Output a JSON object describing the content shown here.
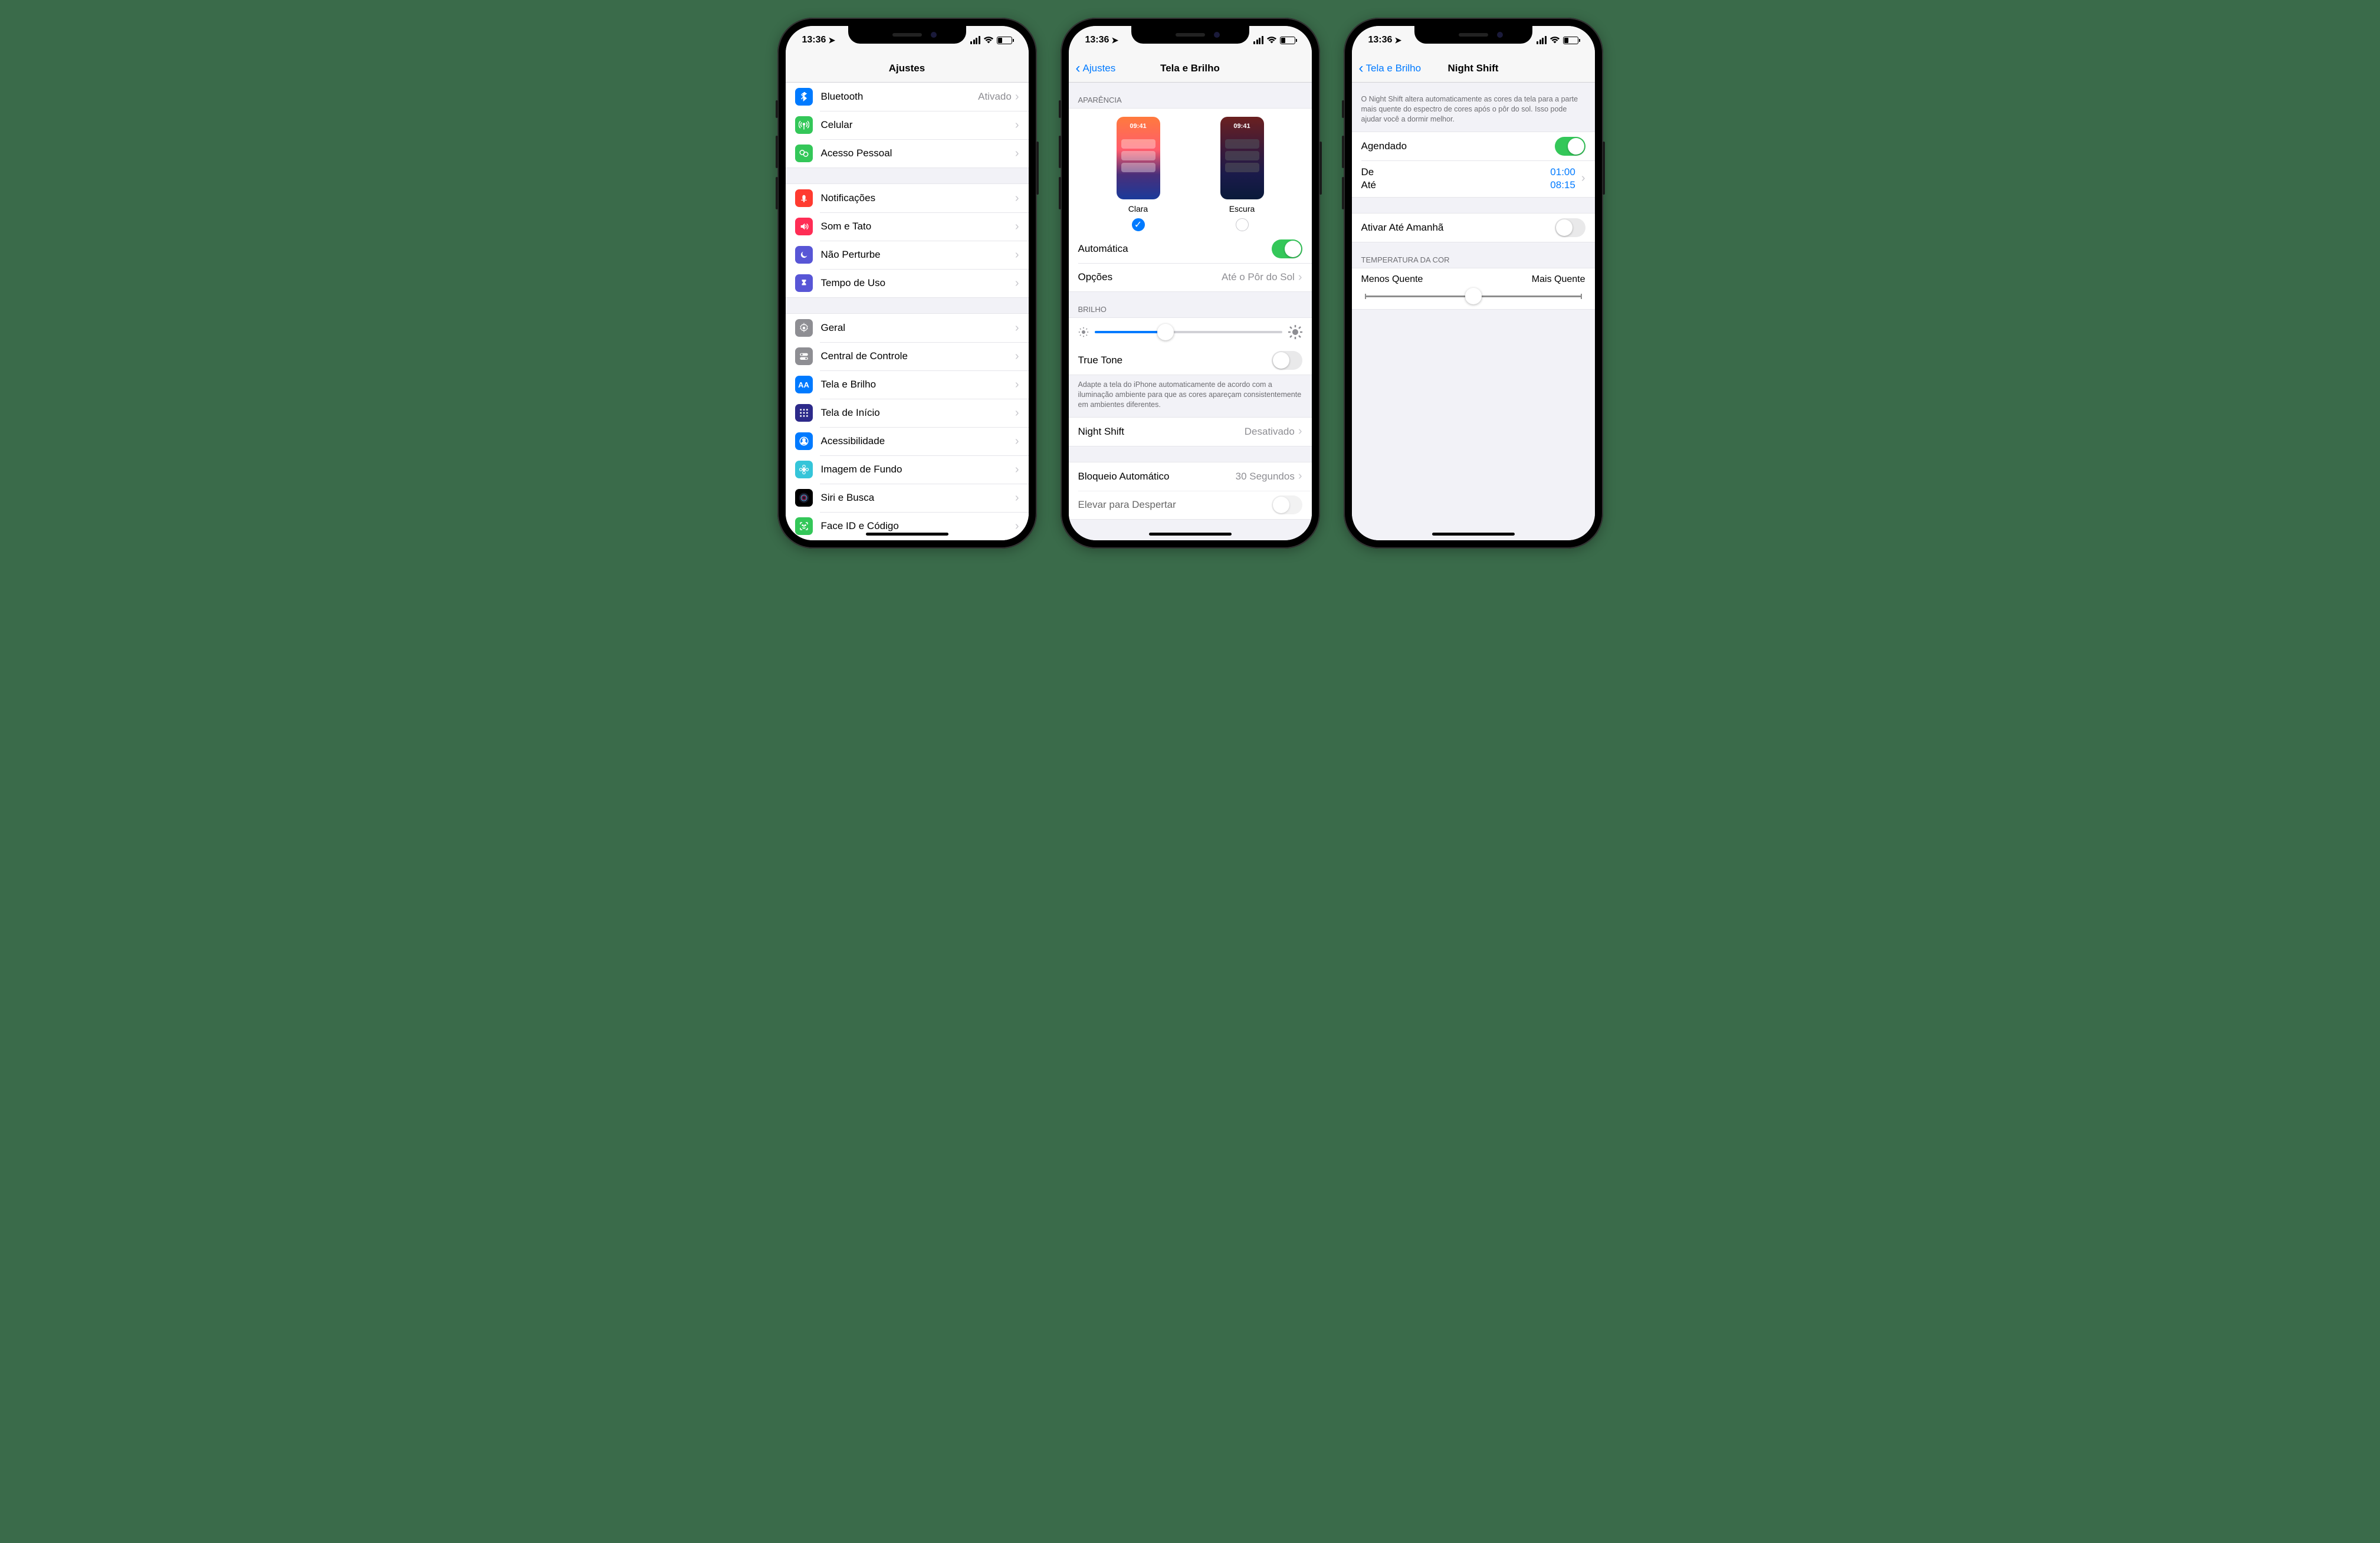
{
  "status": {
    "time": "13:36"
  },
  "screen1": {
    "title": "Ajustes",
    "group1": [
      {
        "icon": "bluetooth",
        "bg": "#007aff",
        "label": "Bluetooth",
        "value": "Ativado"
      },
      {
        "icon": "antenna",
        "bg": "#34c759",
        "label": "Celular",
        "value": ""
      },
      {
        "icon": "hotspot",
        "bg": "#34c759",
        "label": "Acesso Pessoal",
        "value": ""
      }
    ],
    "group2": [
      {
        "icon": "bell",
        "bg": "#ff3b30",
        "label": "Notificações"
      },
      {
        "icon": "speaker",
        "bg": "#ff2d55",
        "label": "Som e Tato"
      },
      {
        "icon": "moon",
        "bg": "#5856d6",
        "label": "Não Perturbe"
      },
      {
        "icon": "hourglass",
        "bg": "#5856d6",
        "label": "Tempo de Uso"
      }
    ],
    "group3": [
      {
        "icon": "gear",
        "bg": "#8e8e93",
        "label": "Geral"
      },
      {
        "icon": "toggles",
        "bg": "#8e8e93",
        "label": "Central de Controle"
      },
      {
        "icon": "AA",
        "bg": "#007aff",
        "label": "Tela e Brilho"
      },
      {
        "icon": "grid",
        "bg": "#2d2a8a",
        "label": "Tela de Início"
      },
      {
        "icon": "person",
        "bg": "#007aff",
        "label": "Acessibilidade"
      },
      {
        "icon": "flower",
        "bg": "#35c5d9",
        "label": "Imagem de Fundo"
      },
      {
        "icon": "siri",
        "bg": "#000",
        "label": "Siri e Busca"
      },
      {
        "icon": "faceid",
        "bg": "#34c759",
        "label": "Face ID e Código"
      }
    ]
  },
  "screen2": {
    "back": "Ajustes",
    "title": "Tela e Brilho",
    "appearance_header": "APARÊNCIA",
    "appearance": {
      "light_label": "Clara",
      "dark_label": "Escura",
      "thumb_time": "09:41"
    },
    "automatic": "Automática",
    "options_label": "Opções",
    "options_value": "Até o Pôr do Sol",
    "brightness_header": "BRILHO",
    "brightness_pct": 38,
    "truetone": "True Tone",
    "truetone_footer": "Adapte a tela do iPhone automaticamente de acordo com a iluminação ambiente para que as cores apareçam consistentemente em ambientes diferentes.",
    "nightshift_label": "Night Shift",
    "nightshift_value": "Desativado",
    "autolock_label": "Bloqueio Automático",
    "autolock_value": "30 Segundos",
    "raise_label": "Elevar para Despertar"
  },
  "screen3": {
    "back": "Tela e Brilho",
    "title": "Night Shift",
    "intro": "O Night Shift altera automaticamente as cores da tela para a parte mais quente do espectro de cores após o pôr do sol. Isso pode ajudar você a dormir melhor.",
    "scheduled": "Agendado",
    "from_label": "De",
    "from_value": "01:00",
    "to_label": "Até",
    "to_value": "08:15",
    "activate_tomorrow": "Ativar Até Amanhã",
    "temp_header": "TEMPERATURA DA COR",
    "temp_less": "Menos Quente",
    "temp_more": "Mais Quente",
    "temp_pct": 50
  }
}
